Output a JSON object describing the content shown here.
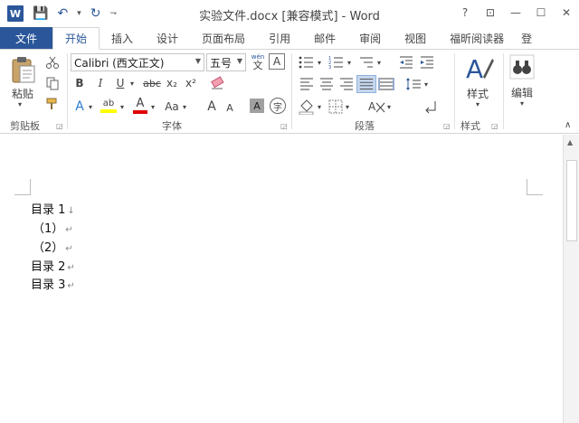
{
  "window": {
    "title": "实验文件.docx [兼容模式] - Word",
    "app_icon": "W",
    "help": "?",
    "ribbon_display": "⊡",
    "minimize": "—",
    "maximize": "☐",
    "close": "✕"
  },
  "qat": {
    "save": "💾",
    "undo": "↶",
    "undo_dd": "▾",
    "redo": "↻",
    "customize": "⇁"
  },
  "tabs": {
    "file": "文件",
    "items": [
      "开始",
      "插入",
      "设计",
      "页面布局",
      "引用",
      "邮件",
      "审阅",
      "视图",
      "福昕阅读器",
      "登"
    ]
  },
  "ribbon": {
    "clipboard": {
      "label": "剪贴板",
      "paste": "粘贴"
    },
    "font": {
      "label": "字体",
      "font_name": "Calibri (西文正文)",
      "font_size": "五号",
      "wen": "wén",
      "wen_char": "文",
      "border_a": "A",
      "bold": "B",
      "italic": "I",
      "underline": "U",
      "strike": "abc",
      "sub": "x₂",
      "sup": "x²",
      "effects": "A",
      "highlight": "ab",
      "color": "A",
      "case": "Aa",
      "grow": "A",
      "shrink": "A",
      "shade": "A",
      "enclose": "字"
    },
    "paragraph": {
      "label": "段落"
    },
    "styles": {
      "label": "样式",
      "btn": "样式"
    },
    "editing": {
      "btn": "编辑"
    },
    "colors": {
      "highlight": "#ffff00",
      "font_color": "#e00000",
      "accent": "#2b579a"
    }
  },
  "document": {
    "lines": [
      {
        "text": "目录 1",
        "mark": "↓"
      },
      {
        "text": "（1）",
        "mark": "↵"
      },
      {
        "text": "（2）",
        "mark": "↵"
      },
      {
        "text": "目录 2",
        "mark": "↵"
      },
      {
        "text": "目录 3",
        "mark": "↵"
      }
    ]
  }
}
